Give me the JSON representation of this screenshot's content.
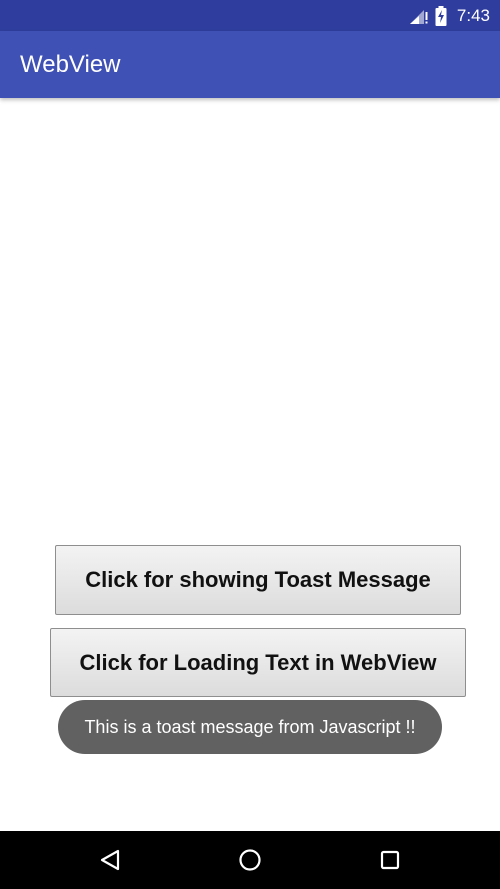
{
  "status_bar": {
    "time": "7:43",
    "icons": [
      "signal-icon",
      "battery-charging-icon"
    ]
  },
  "app_bar": {
    "title": "WebView"
  },
  "webview": {
    "buttons": {
      "toast_label": "Click for showing Toast Message",
      "load_label": "Click for Loading Text in WebView"
    }
  },
  "toast": {
    "message": "This is a toast message from Javascript !!"
  },
  "nav_bar": {
    "icons": [
      "back-icon",
      "home-icon",
      "recents-icon"
    ]
  },
  "colors": {
    "status_bar": "#2f3e9e",
    "app_bar": "#3f51b5",
    "toast_bg": "#616161",
    "nav_bar": "#000000"
  }
}
